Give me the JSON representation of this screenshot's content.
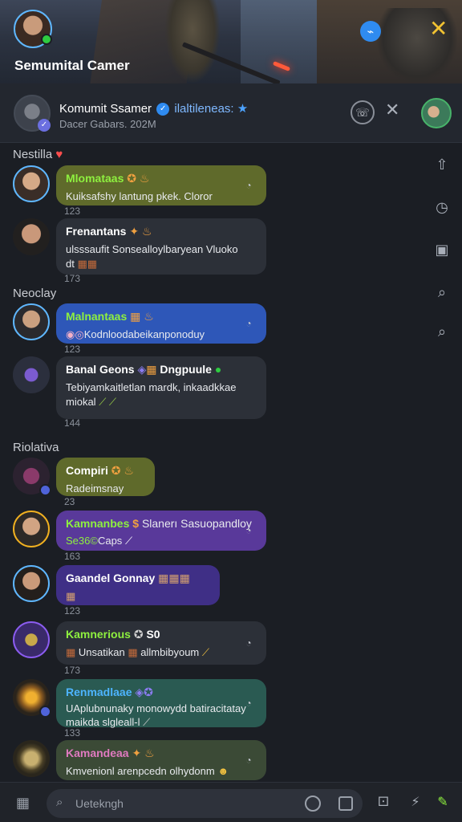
{
  "banner": {
    "title": "Semumital Camer",
    "status_color": "#2ecc40",
    "accent_close_color": "#f1c232",
    "action_icon": "link-icon",
    "close_icon": "close-icon"
  },
  "header": {
    "group_name": "Komumit Ssamer",
    "group_name_extra": "ilaltileneas:",
    "group_sub": "Dacer Gabars. 202M",
    "verified_icon": "check-badge-icon",
    "star_icon": "star-icon",
    "call_icon": "phone-icon",
    "close_icon": "close-icon",
    "profile_icon": "avatar"
  },
  "right_toolbar": [
    "share-icon",
    "clock-icon",
    "calendar-icon",
    "search-icon",
    "search-icon"
  ],
  "sections": {
    "first": "Nestilla",
    "second": "Neoclay",
    "third": "Riolativa"
  },
  "messages": [
    {
      "name": "Mlomataas",
      "name_color": "#8ef03f",
      "text": "Kuiksafshy lantung pkek. Cloror",
      "count": "123",
      "bubble": "olive"
    },
    {
      "name": "Frenantans",
      "name_color": "#ffffff",
      "text": "ulsssaufit Sonsealloylbaryean Vluoko",
      "text2": "dt",
      "count": "173",
      "bubble": "dark"
    },
    {
      "name": "Malnantaas",
      "name_color": "#8ef03f",
      "text": "Kodnloodabeikanponoduy",
      "count": "123",
      "bubble": "blue"
    },
    {
      "name": "Banal Geons",
      "name_extra": "Dngpuule",
      "name_color": "#ffffff",
      "text": "Tebiyamkaitletlan mardk, inkaadkkae",
      "text2": "miokal",
      "count": "144",
      "bubble": "dark"
    },
    {
      "name": "Compiri",
      "name_color": "#ffffff",
      "text": "Radeimsnay",
      "count": "23",
      "bubble": "olive"
    },
    {
      "name": "Kamnanbes",
      "name_extra": "Slanerı Sasuopandloy",
      "name_color": "#8ef03f",
      "text": "Caps",
      "text_prefix": "Se36©",
      "count": "163",
      "bubble": "purple"
    },
    {
      "name": "Gaandel Gonnay",
      "name_color": "#ffffff",
      "text": "",
      "count": "123",
      "bubble": "indigo"
    },
    {
      "name": "Kamnerious",
      "name_extra": "S0",
      "name_color": "#8ef03f",
      "text": "Unsatikan",
      "text2": "allmbibyoum",
      "count": "173",
      "bubble": "dark"
    },
    {
      "name": "Renmadlaae",
      "name_color": "#4db4ff",
      "text": "UAplubnunaky monowydd batiracitatay",
      "text2": "maikda slgleall-l",
      "count": "133",
      "bubble": "teal"
    },
    {
      "name": "Kamandeaa",
      "name_color": "#e07ac0",
      "text": "Kmvenionl arenpcedn olhydonm",
      "count": "",
      "bubble": "dgreen"
    }
  ],
  "composer": {
    "placeholder": "Uetekngh",
    "menu_icon": "grid-icon",
    "search_icon": "search-icon",
    "emoji_icon": "emoji-icon",
    "attach_icon": "image-icon",
    "dice_icon": "dice-icon",
    "bolt_icon": "bolt-icon",
    "game_icon": "game-icon"
  }
}
